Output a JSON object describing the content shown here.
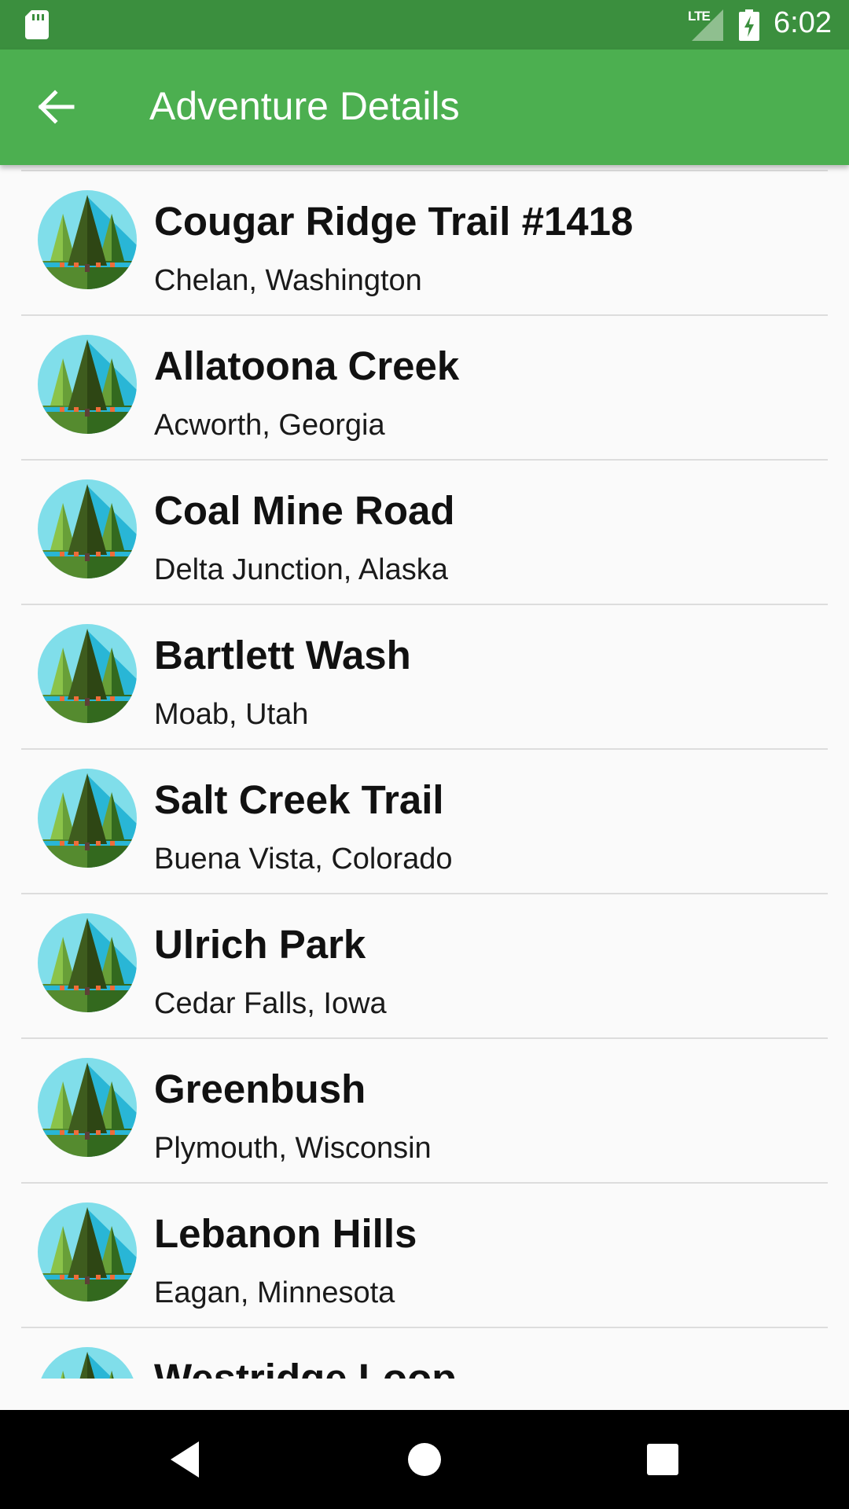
{
  "status_bar": {
    "time": "6:02",
    "network": "LTE"
  },
  "app_bar": {
    "title": "Adventure Details"
  },
  "colors": {
    "status_bar": "#3b8f3e",
    "app_bar": "#4caf50",
    "background": "#fafafa"
  },
  "trails": [
    {
      "name": "Cougar Ridge Trail #1418",
      "location": "Chelan, Washington"
    },
    {
      "name": "Allatoona Creek",
      "location": "Acworth, Georgia"
    },
    {
      "name": "Coal Mine Road",
      "location": "Delta Junction, Alaska"
    },
    {
      "name": "Bartlett Wash",
      "location": "Moab, Utah"
    },
    {
      "name": "Salt Creek Trail",
      "location": "Buena Vista, Colorado"
    },
    {
      "name": "Ulrich Park",
      "location": "Cedar Falls, Iowa"
    },
    {
      "name": "Greenbush",
      "location": "Plymouth, Wisconsin"
    },
    {
      "name": "Lebanon Hills",
      "location": "Eagan, Minnesota"
    },
    {
      "name": "Westridge Loop",
      "location": ""
    }
  ]
}
